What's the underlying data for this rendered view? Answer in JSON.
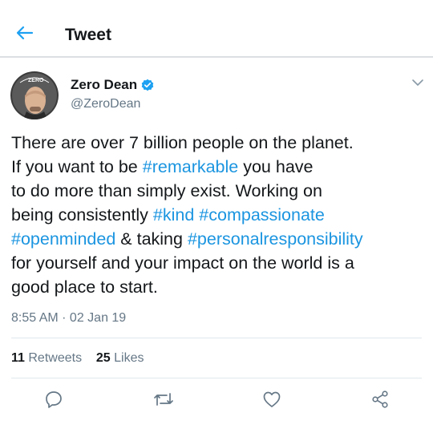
{
  "header": {
    "title": "Tweet",
    "back_icon": "arrow-left-icon",
    "accent": "#1da1f2"
  },
  "tweet": {
    "author_name": "Zero Dean",
    "handle": "@ZeroDean",
    "verified_icon": "verified-badge-icon",
    "avatar_text": "ZERO",
    "text_lines": [
      [
        {
          "t": "There are over 7 billion people on the planet.",
          "h": false
        }
      ],
      [
        {
          "t": "If you want to be ",
          "h": false
        },
        {
          "t": "#remarkable",
          "h": true
        },
        {
          "t": " you have",
          "h": false
        }
      ],
      [
        {
          "t": "to do more than simply exist. Working on",
          "h": false
        }
      ],
      [
        {
          "t": "being consistently ",
          "h": false
        },
        {
          "t": "#kind",
          "h": true
        },
        {
          "t": " ",
          "h": false
        },
        {
          "t": "#compassionate",
          "h": true
        }
      ],
      [
        {
          "t": "#openminded",
          "h": true
        },
        {
          "t": " & taking ",
          "h": false
        },
        {
          "t": "#personalresponsibility",
          "h": true
        }
      ],
      [
        {
          "t": "for yourself and your impact on the world is a",
          "h": false
        }
      ],
      [
        {
          "t": "good place to start.",
          "h": false
        }
      ]
    ],
    "timestamp": "8:55 AM · 02 Jan 19",
    "retweets_count": "11",
    "retweets_label": "Retweets",
    "likes_count": "25",
    "likes_label": "Likes",
    "hashtag_color": "#1b95e0"
  },
  "actions": [
    {
      "name": "reply-button",
      "icon": "reply-icon"
    },
    {
      "name": "retweet-button",
      "icon": "retweet-icon"
    },
    {
      "name": "like-button",
      "icon": "heart-icon"
    },
    {
      "name": "share-button",
      "icon": "share-icon"
    }
  ]
}
